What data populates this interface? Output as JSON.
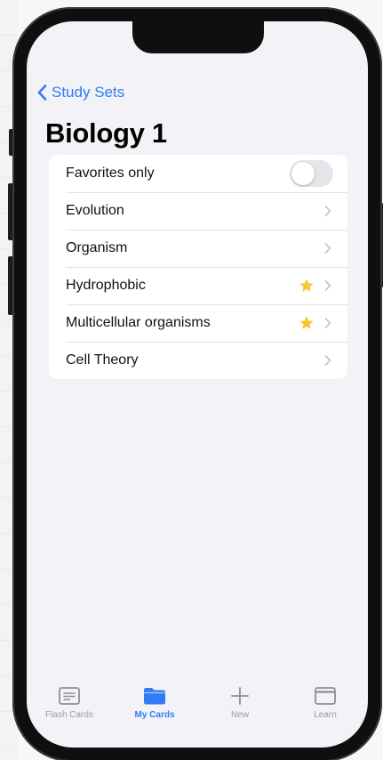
{
  "nav": {
    "back_label": "Study Sets",
    "title": "Biology 1"
  },
  "list": {
    "favorites_toggle": {
      "label": "Favorites only",
      "on": false
    },
    "items": [
      {
        "label": "Evolution",
        "favorite": false
      },
      {
        "label": "Organism",
        "favorite": false
      },
      {
        "label": "Hydrophobic",
        "favorite": true
      },
      {
        "label": "Multicellular organisms",
        "favorite": true
      },
      {
        "label": "Cell Theory",
        "favorite": false
      }
    ]
  },
  "tabbar": {
    "tabs": [
      {
        "label": "Flash Cards",
        "icon": "flashcards-icon",
        "active": false
      },
      {
        "label": "My Cards",
        "icon": "folder-icon",
        "active": true
      },
      {
        "label": "New",
        "icon": "plus-icon",
        "active": false
      },
      {
        "label": "Learn",
        "icon": "window-icon",
        "active": false
      }
    ]
  },
  "colors": {
    "accent": "#2f7cf6",
    "star": "#f7c52f",
    "background": "#f2f2f7",
    "inactive_tab": "#9a9aa0"
  }
}
